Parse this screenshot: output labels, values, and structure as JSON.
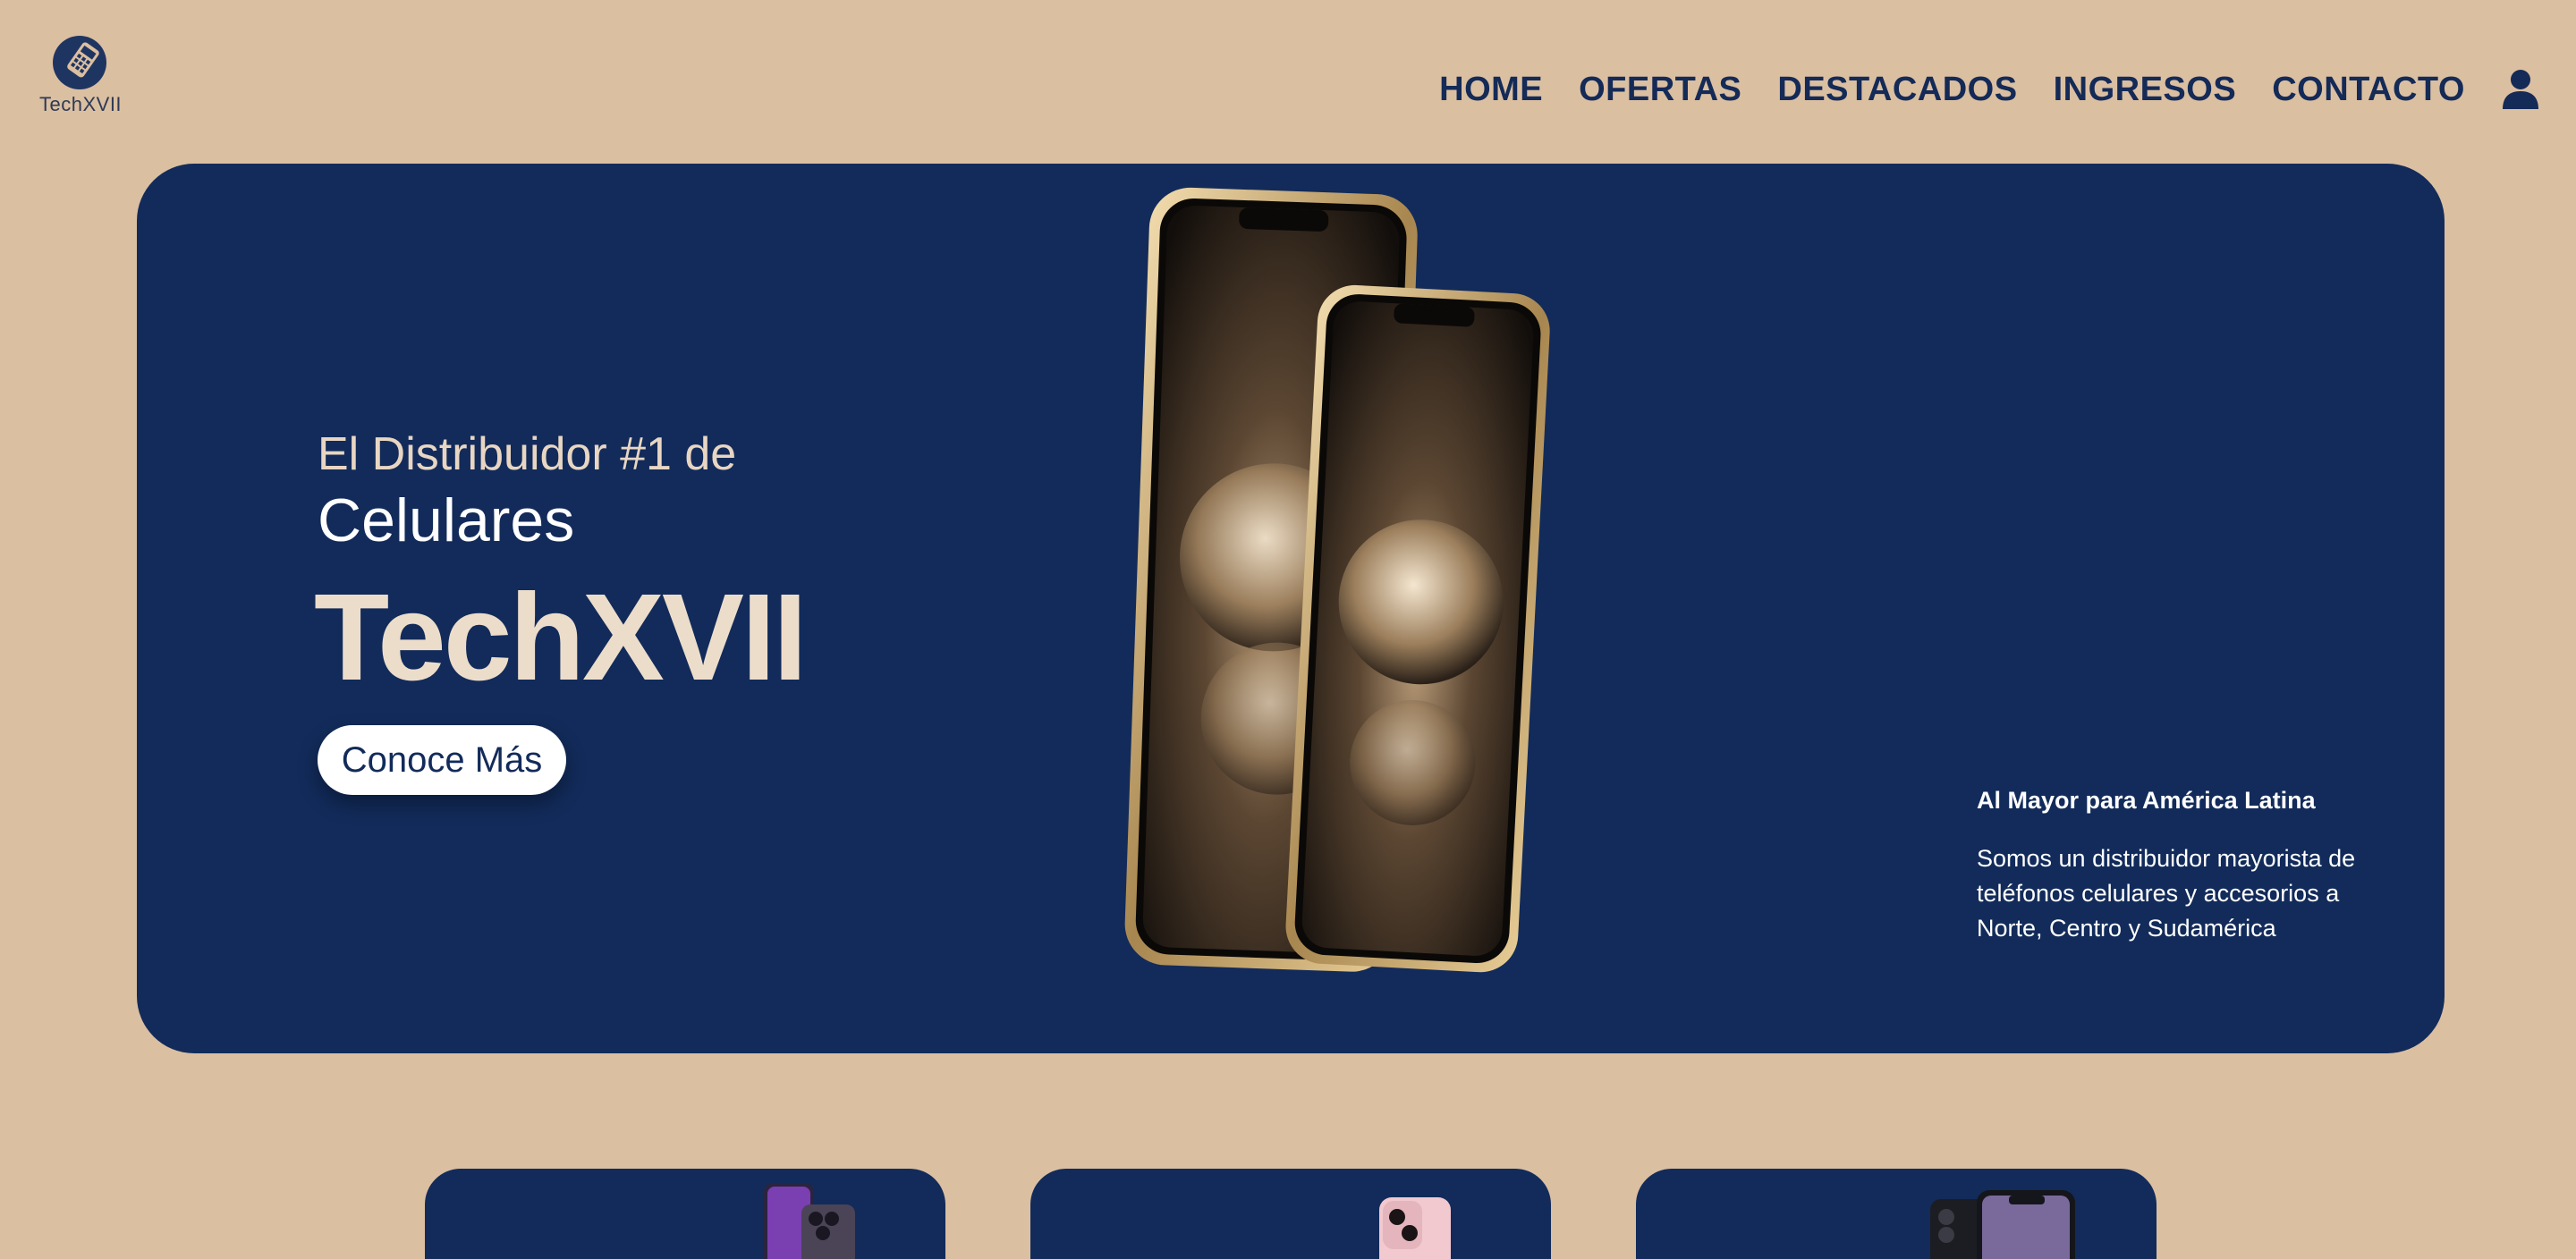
{
  "header": {
    "logo_text": "TechXVII",
    "nav": [
      "HOME",
      "OFERTAS",
      "DESTACADOS",
      "INGRESOS",
      "CONTACTO"
    ],
    "user_icon": "user-icon"
  },
  "hero": {
    "subtitle": "El Distribuidor #1 de",
    "title": "Celulares",
    "brand": "TechXVII",
    "button_label": "Conoce Más",
    "side_title": "Al Mayor para América Latina",
    "side_text": "Somos un distribuidor mayorista de teléfonos celulares y accesorios a Norte, Centro y Sudamérica"
  },
  "colors": {
    "background": "#dbbfa1",
    "navy": "#122b5a",
    "cream": "#ecddcb"
  }
}
